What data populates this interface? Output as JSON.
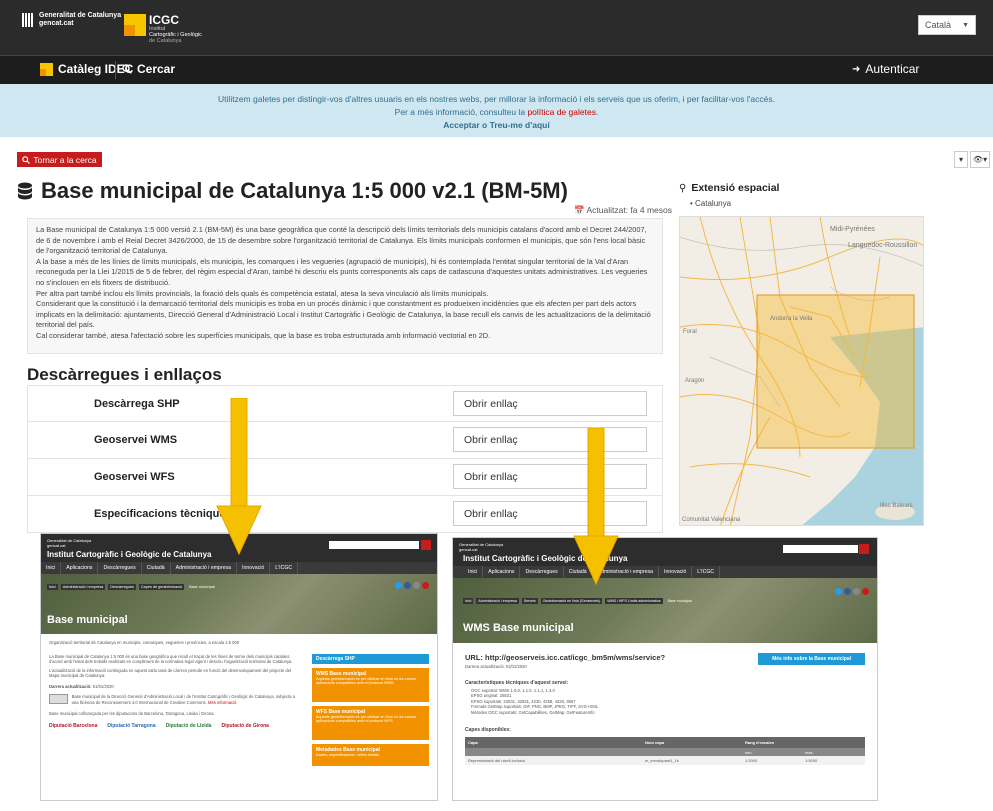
{
  "header": {
    "gencat_line1": "Generalitat de Catalunya",
    "gencat_line2": "gencat.cat",
    "icgc_logo": "ICGC",
    "icgc_sub1": "Institut",
    "icgc_sub2": "Cartogràfic i Geològic",
    "icgc_sub3": "de Catalunya",
    "language": "Català"
  },
  "nav": {
    "catalog": "Catàleg IDEC",
    "search": "Cercar",
    "login": "Autenticar"
  },
  "cookie": {
    "line1": "Utilitzem galetes per distingir-vos d'altres usuaris en els nostres webs, per millorar la informació i els serveis que us oferim, i per facilitar-vos l'accés.",
    "line2_prefix": "Per a més informació, consulteu la",
    "line2_link": "política de galetes",
    "line2_suffix": ".",
    "accept": "Acceptar",
    "or": "o",
    "remove": "Treu-me d'aquí"
  },
  "back": "Tornar a la cerca",
  "title": "Base municipal de Catalunya 1:5 000 v2.1 (BM-5M)",
  "updated": "Actualitzat: fa 4 mesos",
  "description": [
    "La Base municipal de Catalunya 1:5 000 versió 2.1 (BM-5M) és una base geogràfica que conté la descripció dels límits territorials dels municipis catalans d'acord amb el Decret 244/2007, de 6 de novembre i amb el Reial Decret 3426/2000, de 15 de desembre sobre l'organització territorial de Catalunya. Els límits municipals conformen el municipis, que són l'ens local bàsic de l'organització territorial de Catalunya.",
    "A la base a més de les línies de límits municipals, els municipis, les comarques i les vegueries (agrupació de municipis), hi és contemplada l'entitat singular territorial de la Val d'Aran reconeguda per la Llei 1/2015 de 5 de febrer, del règim especial d'Aran, també hi descriu els punts corresponents als caps de cadascuna d'aquestes unitats administratives. Les vegueries no s'inclouen en els fitxers de distribució.",
    "Per altra part també inclou els límits provincials, la fixació dels quals és competència estatal, atesa la seva vinculació als límits municipals.",
    "Considerant que la constitució i la demarcació territorial dels municipis es troba en un procés dinàmic i que constantment es produeixen incidències que els afecten per part dels actors implicats en la delimitació: ajuntaments, Direcció General d'Administració Local i Institut Cartogràfic i Geològic de Catalunya, la base recull els canvis de les actualitzacions de la delimitació territorial del país.",
    "Cal considerar també, atesa l'afectació sobre les superfícies municipals, que la base es troba estructurada amb informació vectorial en 2D."
  ],
  "downloads": {
    "title": "Descàrregues i enllaços",
    "rows": [
      {
        "label": "Descàrrega SHP",
        "button": "Obrir enllaç"
      },
      {
        "label": "Geoservei WMS",
        "button": "Obrir enllaç"
      },
      {
        "label": "Geoservei WFS",
        "button": "Obrir enllaç"
      },
      {
        "label": "Especificacions tècniques",
        "button": "Obrir enllaç"
      }
    ]
  },
  "extent": {
    "title": "Extensió espacial",
    "item": "Catalunya",
    "map_labels": [
      "Midi-Pyrénées",
      "Languedoc-Roussillon",
      "Foral",
      "Andorra la Vella",
      "Aragón",
      "Comunitat Valenciana",
      "Illes Balears"
    ]
  },
  "shot1": {
    "brand1": "Generalitat de Catalunya",
    "brand2": "gencat.cat",
    "site": "Institut Cartogràfic i Geològic de Catalunya",
    "nav": [
      "Inici",
      "Aplicacions",
      "Descàrregues",
      "Ciutadà",
      "Administració i empresa",
      "Innovació",
      "L'ICGC"
    ],
    "crumbs": [
      "Inici",
      "Administració i empresa",
      "Descàrregues",
      "Capes de geoinformació",
      "Base municipal"
    ],
    "hero": "Base municipal",
    "intro": "Organització territorial de Catalunya en municipis, comarques, vegueries i províncies, a escala 1:5 000",
    "p1": "La Base municipal de Catalunya 1:5 000 és una base geogràfica que recull el traçat de les línies de terme dels municipis catalans d'acord amb l'estat dels treballs realitzats en compliment de la normativa legal vigent i descriu l'organització territorial de Catalunya.",
    "p2": "L'actualització de la informació continguda en aquest atzlu tanà de càrrecs periode en funció del desenvolupament del projecte del Mapa municipal de Catalunya.",
    "last_label": "Darrera actualització:",
    "last_date": "01/01/2020",
    "license": "Base municipal de la Direcció General d'Administració Local i de l'Institut Cartogràfic i Geològic de Catalunya, subjecta a una llicència de Reconeixement 4.0 Internacional de Creative Commons.",
    "more": "Més informació",
    "cofund": "Base municipal cofinançada per les diputacions de Barcelona, Tarragona, Lleida i Girona.",
    "side": [
      {
        "title": "Descàrrega SHP",
        "text": ""
      },
      {
        "title": "WMS Base municipal",
        "text": "Aquests geoinformació és per utilitzar en línia en les xarxes aplicacions compatibles amb el protocol WMS."
      },
      {
        "title": "WFS Base municipal",
        "text": "Aquests geoinformació és per utilitzar en línia en les xarxes aplicacions compatibles amb el protocol WFS."
      },
      {
        "title": "Metadades Base municipal",
        "text": "Dades, especificacions i altres detalls"
      }
    ],
    "logos": [
      "Diputació Barcelona",
      "Diputació Tarragona",
      "Diputació de Lleida",
      "Diputació de Girona"
    ]
  },
  "shot2": {
    "hero": "WMS Base municipal",
    "crumbs": [
      "Inici",
      "Administració i empresa",
      "Serveis",
      "Geoinformació en línia (Geoserveis)",
      "WMS i WFS Límits administratius",
      "Base municipal"
    ],
    "url": "URL: http://geoserveis.icc.cat/icgc_bm5m/wms/service?",
    "last": "Darrera actualització: 01/01/2020",
    "more_btn": "Més info sobre la Base municipal",
    "tech_title": "Característiques tècniques d'aquest servei:",
    "tech": [
      "OGC suportat: WMS 1.0.0, 1.1.0, 1.1.1, 1.3.0",
      "EPSG original: 25831",
      "EPSG suportats: 23031, 32631, 4230, 4258, 4326, 3857",
      "Formats GetMap suportats: GIF, PNG, BMP, JPEG, TIFF, SVG+XML",
      "Mètodes OGC suportats: GetCapabilities, GetMap, GetFeatureInfo"
    ],
    "layers_title": "Capes disponibles:",
    "cols": [
      "Capa",
      "Nom capa",
      "Rang d'escales"
    ],
    "subcols": [
      "min.",
      "màx."
    ],
    "row": [
      "Representació del nivell inclusiu",
      "m_envolupant1_1k",
      "1:2000",
      "1:5000"
    ]
  }
}
